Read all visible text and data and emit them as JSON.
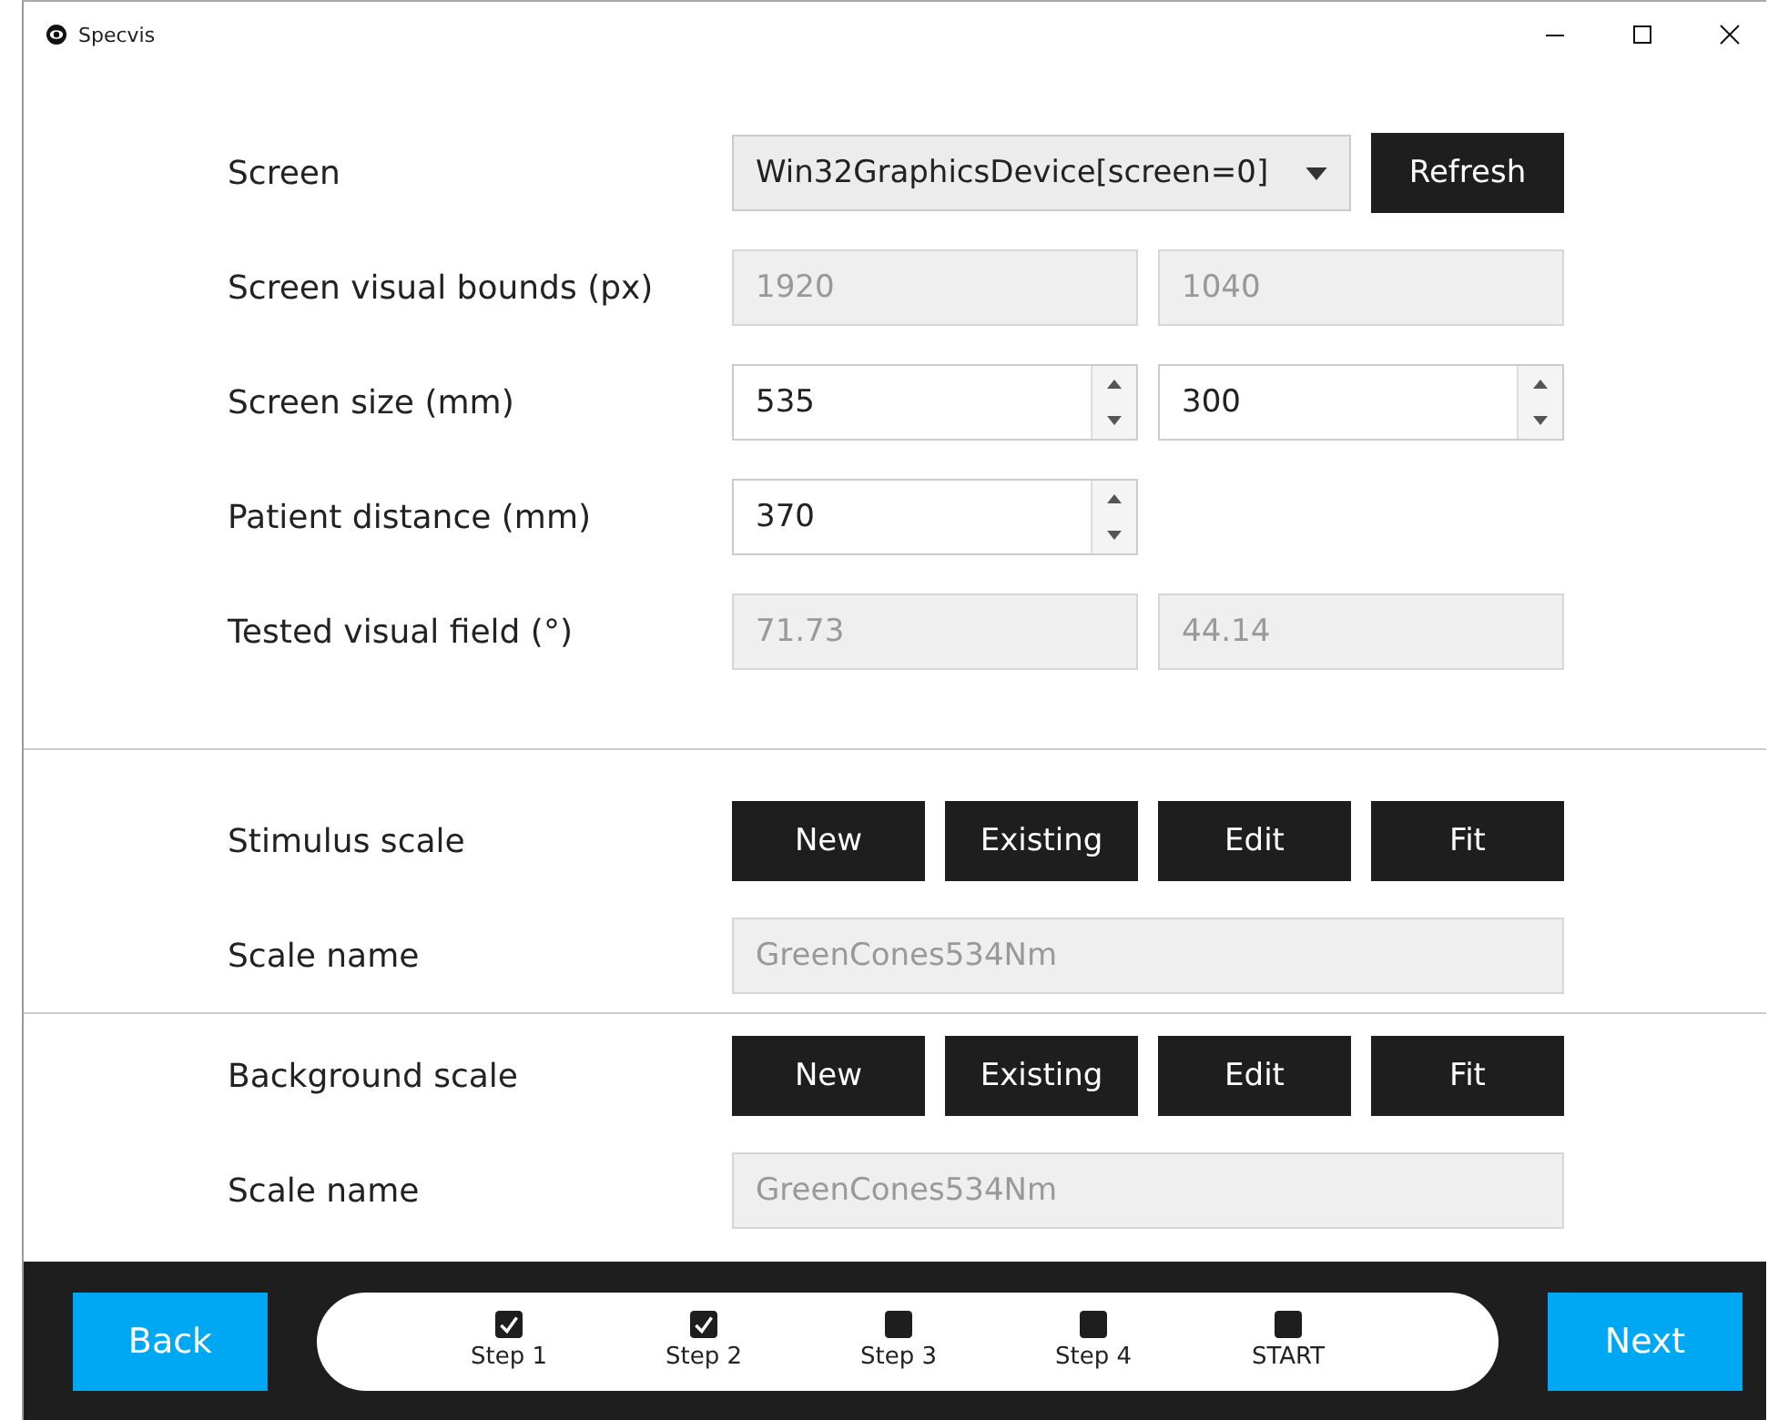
{
  "window": {
    "title": "Specvis"
  },
  "sections": [
    {
      "rows": [
        {
          "kind": "select",
          "label": "Screen",
          "value": "Win32GraphicsDevice[screen=0]",
          "button": "Refresh"
        },
        {
          "kind": "readonly",
          "label": "Screen visual bounds (px)",
          "values": [
            "1920",
            "1040"
          ]
        },
        {
          "kind": "spinner",
          "label": "Screen size (mm)",
          "values": [
            "535",
            "300"
          ]
        },
        {
          "kind": "spinner",
          "label": "Patient distance (mm)",
          "values": [
            "370"
          ]
        },
        {
          "kind": "readonly",
          "label": "Tested visual field (°)",
          "values": [
            "71.73",
            "44.14"
          ]
        }
      ]
    },
    {
      "rows": [
        {
          "kind": "buttons",
          "label": "Stimulus scale",
          "buttons": [
            "New",
            "Existing",
            "Edit",
            "Fit"
          ]
        },
        {
          "kind": "readonly",
          "label": "Scale name",
          "values": [
            "GreenCones534Nm"
          ]
        }
      ]
    },
    {
      "rows": [
        {
          "kind": "buttons",
          "label": "Background scale",
          "buttons": [
            "New",
            "Existing",
            "Edit",
            "Fit"
          ]
        },
        {
          "kind": "readonly",
          "label": "Scale name",
          "values": [
            "GreenCones534Nm"
          ]
        }
      ]
    }
  ],
  "footer": {
    "back": "Back",
    "next": "Next",
    "steps": [
      {
        "label": "Step 1",
        "checked": true
      },
      {
        "label": "Step 2",
        "checked": true
      },
      {
        "label": "Step 3",
        "checked": false
      },
      {
        "label": "Step 4",
        "checked": false
      },
      {
        "label": "START",
        "checked": false
      }
    ]
  }
}
